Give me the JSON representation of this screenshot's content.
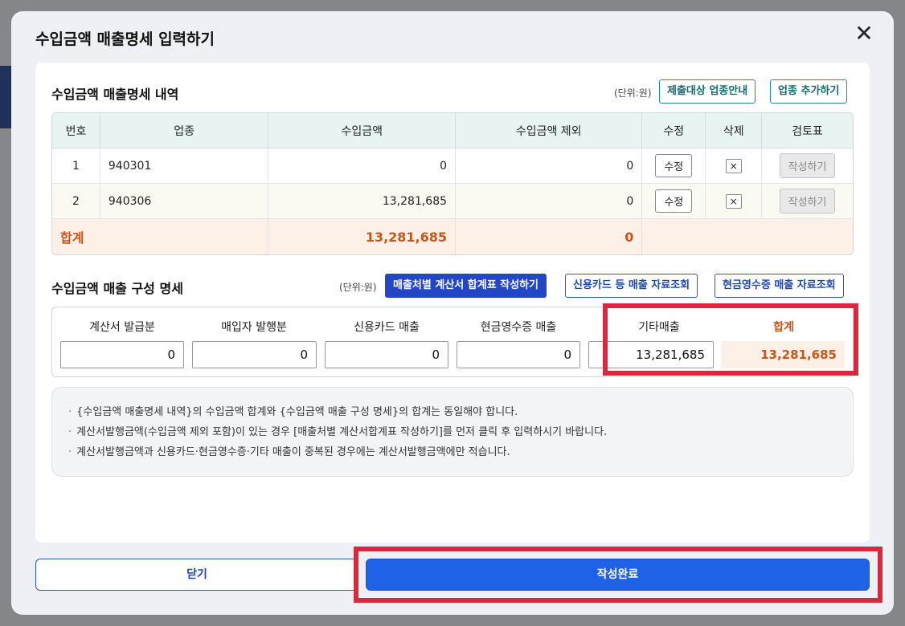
{
  "modal": {
    "title": "수입금액 매출명세 입력하기",
    "close_symbol": "✕"
  },
  "detail_section": {
    "title": "수입금액 매출명세 내역",
    "unit": "(단위:원)",
    "btn_guide": "제출대상 업종안내",
    "btn_add": "업종 추가하기",
    "columns": [
      "번호",
      "업종",
      "수입금액",
      "수입금액 제외",
      "수정",
      "삭제",
      "검토표"
    ],
    "rows": [
      {
        "no": "1",
        "industry": "940301",
        "amount": "0",
        "excluded": "0",
        "edit": "수정",
        "delete": "×",
        "review": "작성하기"
      },
      {
        "no": "2",
        "industry": "940306",
        "amount": "13,281,685",
        "excluded": "0",
        "edit": "수정",
        "delete": "×",
        "review": "작성하기"
      }
    ],
    "total": {
      "label": "합계",
      "amount": "13,281,685",
      "excluded": "0"
    }
  },
  "composition_section": {
    "title": "수입금액 매출 구성 명세",
    "unit": "(단위:원)",
    "btn_invoice_total": "매출처별 계산서 합계표 작성하기",
    "btn_card": "신용카드 등 매출 자료조회",
    "btn_cash": "현금영수증 매출 자료조회",
    "fields": [
      {
        "label": "계산서 발급분",
        "value": "0"
      },
      {
        "label": "매입자 발행분",
        "value": "0"
      },
      {
        "label": "신용카드 매출",
        "value": "0"
      },
      {
        "label": "현금영수증 매출",
        "value": "0"
      },
      {
        "label": "기타매출",
        "value": "13,281,685"
      }
    ],
    "total": {
      "label": "합계",
      "value": "13,281,685"
    }
  },
  "notices": [
    "{수입금액 매출명세 내역}의 수입금액 합계와 {수입금액 매출 구성 명세}의 합계는 동일해야 합니다.",
    "계산서발행금액(수입금액 제외 포함)이 있는 경우 [매출처별 계산서합계표 작성하기]를 먼저 클릭 후 입력하시기 바랍니다.",
    "계산서발행금액과 신용카드·현금영수증·기타 매출이 중복된 경우에는 계산서발행금액에만 적습니다."
  ],
  "footer": {
    "close_label": "닫기",
    "done_label": "작성완료"
  },
  "colors": {
    "highlight_box": "#d8283c",
    "primary_button": "#1f62e8",
    "total_text": "#c8561a"
  }
}
